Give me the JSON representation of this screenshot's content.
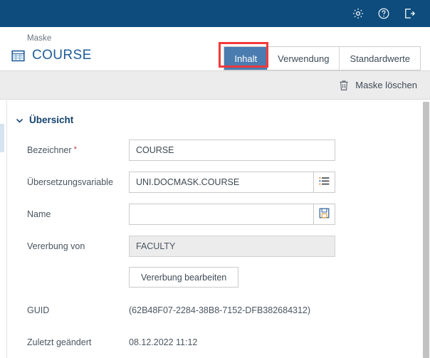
{
  "topbar": {
    "background": "#0d4c7c",
    "icons": [
      {
        "name": "settings-icon",
        "label": "Einstellungen"
      },
      {
        "name": "help-icon",
        "label": "Hilfe"
      },
      {
        "name": "logout-icon",
        "label": "Abmelden"
      }
    ]
  },
  "header": {
    "breadcrumb": "Maske",
    "title": "COURSE",
    "title_icon": "table-icon",
    "title_color": "#1f5c99"
  },
  "tabs": {
    "items": [
      {
        "label": "Inhalt",
        "active": true
      },
      {
        "label": "Verwendung",
        "active": false
      },
      {
        "label": "Standardwerte",
        "active": false
      }
    ],
    "active_background": "#4a7cb0",
    "highlight_color": "#f23a3a"
  },
  "actionbar": {
    "delete_label": "Maske löschen",
    "delete_icon": "trash-icon"
  },
  "section": {
    "title": "Übersicht",
    "chevron_icon": "chevron-down-icon",
    "title_color": "#14426e"
  },
  "form": {
    "rows": [
      {
        "label": "Bezeichner",
        "required": true,
        "type": "input",
        "value": "COURSE",
        "placeholder": "",
        "readonly": false,
        "button_icon": null
      },
      {
        "label": "Übersetzungsvariable",
        "required": false,
        "type": "input",
        "value": "UNI.DOCMASK.COURSE",
        "placeholder": "",
        "readonly": false,
        "button_icon": "list-icon"
      },
      {
        "label": "Name",
        "required": false,
        "type": "input",
        "value": "",
        "placeholder": "",
        "readonly": false,
        "button_icon": "save-icon"
      },
      {
        "label": "Vererbung von",
        "required": false,
        "type": "input",
        "value": "FACULTY",
        "placeholder": "",
        "readonly": true,
        "button_icon": null
      }
    ],
    "inherit_button_label": "Vererbung bearbeiten",
    "readonly_rows": [
      {
        "label": "GUID",
        "value": "(62B48F07-2284-38B8-7152-DFB382684312)"
      },
      {
        "label": "Zuletzt geändert",
        "value": "08.12.2022 11:12"
      }
    ]
  },
  "scrollbars": {
    "left_thumb_color": "#d6e4f0",
    "right_thumb_color": "#c2c2c2"
  }
}
